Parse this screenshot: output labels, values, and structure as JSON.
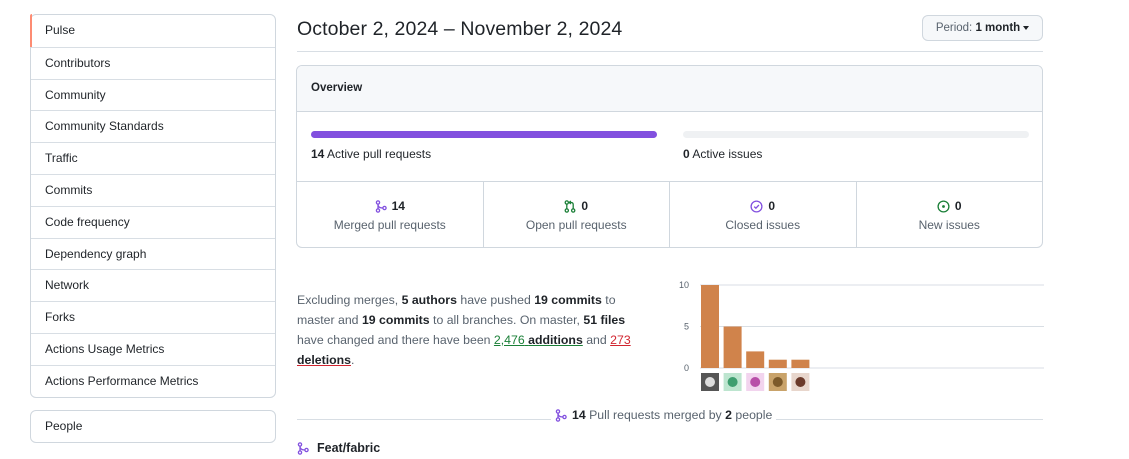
{
  "sidebar": {
    "items": [
      {
        "label": "Pulse",
        "selected": true
      },
      {
        "label": "Contributors"
      },
      {
        "label": "Community"
      },
      {
        "label": "Community Standards"
      },
      {
        "label": "Traffic"
      },
      {
        "label": "Commits"
      },
      {
        "label": "Code frequency"
      },
      {
        "label": "Dependency graph"
      },
      {
        "label": "Network"
      },
      {
        "label": "Forks"
      },
      {
        "label": "Actions Usage Metrics"
      },
      {
        "label": "Actions Performance Metrics"
      }
    ],
    "secondary": [
      {
        "label": "People"
      }
    ]
  },
  "header": {
    "date_range": "October 2, 2024 – November 2, 2024",
    "period_label": "Period:",
    "period_value": "1 month"
  },
  "overview": {
    "title": "Overview",
    "active_prs": {
      "count": "14",
      "label": "Active pull requests",
      "fill_fraction": 1.0
    },
    "active_issues": {
      "count": "0",
      "label": "Active issues",
      "fill_fraction": 0.0
    },
    "stats": [
      {
        "icon": "git-merge-icon",
        "value": "14",
        "label": "Merged pull requests",
        "color": "#8250df"
      },
      {
        "icon": "git-pull-request-icon",
        "value": "0",
        "label": "Open pull requests",
        "color": "#1a7f37"
      },
      {
        "icon": "issue-closed-icon",
        "value": "0",
        "label": "Closed issues",
        "color": "#8250df"
      },
      {
        "icon": "issue-opened-icon",
        "value": "0",
        "label": "New issues",
        "color": "#1a7f37"
      }
    ]
  },
  "summary": {
    "t1": "Excluding merges, ",
    "authors": "5 authors",
    "t2": " have pushed ",
    "commits_master": "19 commits",
    "t3": " to master and ",
    "commits_all": "19 commits",
    "t4": " to all branches. On master, ",
    "files": "51 files",
    "t5": " have changed and there have been ",
    "additions_num": "2,476",
    "additions_word": "additions",
    "t6": " and ",
    "deletions_num": "273",
    "deletions_word": "deletions",
    "t7": "."
  },
  "chart_data": {
    "type": "bar",
    "categories": [
      "author-1",
      "author-2",
      "author-3",
      "author-4",
      "author-5"
    ],
    "values": [
      10,
      5,
      2,
      1,
      1
    ],
    "ylim": [
      0,
      10
    ],
    "yticks": [
      "0",
      "5",
      "10"
    ],
    "bar_color": "#d0834b",
    "grid": true
  },
  "merged": {
    "count": "14",
    "text_mid": " Pull requests merged by ",
    "people": "2",
    "text_end": " people"
  },
  "pull_requests": [
    {
      "title": "Feat/fabric"
    }
  ]
}
